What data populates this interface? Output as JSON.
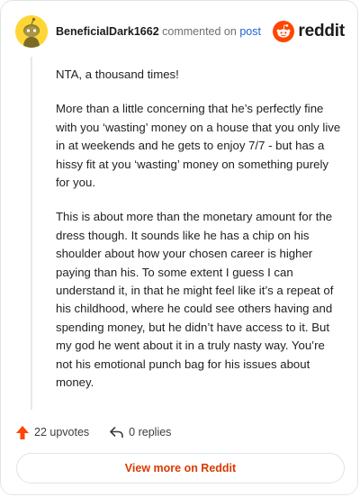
{
  "header": {
    "username": "BeneficialDark1662",
    "verb": "commented on",
    "post_link": "post",
    "brand": "reddit"
  },
  "comment": {
    "paragraphs": [
      "NTA, a thousand times!",
      "More than a little concerning that he’s perfectly fine with you ‘wasting’ money on a house that you only live in at weekends and he gets to enjoy 7/7 - but has a hissy fit at you ‘wasting’ money on something purely for you.",
      "This is about more than the monetary amount for the dress though. It sounds like he has a chip on his shoulder about how your chosen career is higher paying than his. To some extent I guess I can understand it, in that he might feel like it’s a repeat of his childhood, where he could see others having and spending money, but he didn’t have access to it. But my god he went about it in a truly nasty way. You’re not his emotional punch bag for his issues about money."
    ]
  },
  "actions": {
    "upvotes": "22 upvotes",
    "replies": "0 replies"
  },
  "view_more": "View more on Reddit",
  "colors": {
    "accent": "#d93a00",
    "link": "#1a63d8",
    "upvote": "#ff4500",
    "avatar_bg": "#ffd635"
  },
  "icons": {
    "avatar": "snoo-avatar-icon",
    "brand": "reddit-logo-icon",
    "upvote": "upvote-arrow-icon",
    "reply": "reply-arrow-icon"
  }
}
